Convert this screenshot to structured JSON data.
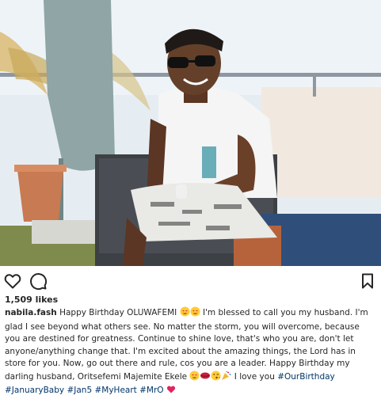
{
  "post": {
    "likes_text": "1,509 likes",
    "caption": {
      "username": "nabila.fash",
      "part1": "Happy Birthday OLUWAFEMI",
      "part2": "I'm blessed to call you my husband. I'm glad I see beyond what others see. No matter the storm, you will overcome, because you are destined for greatness. Continue to shine love, that's who you are, don't let anyone/anything change that. I'm excited about the amazing things, the Lord has in store for you. Now, go out there and rule, cos you are a leader. Happy Birthday my darling husband, Oritsefemi Majemite Ekele",
      "part3": "I love you",
      "hashtags": [
        "#OurBirthday",
        "#JanuaryBaby",
        "#Jan5",
        "#MyHeart",
        "#MrO"
      ]
    },
    "icons": {
      "like": "heart-outline-icon",
      "comment": "comment-bubble-icon",
      "save": "bookmark-icon"
    },
    "colors": {
      "text": "#262626",
      "hashtag": "#003569",
      "heart_emoji": "#e0245e"
    }
  }
}
